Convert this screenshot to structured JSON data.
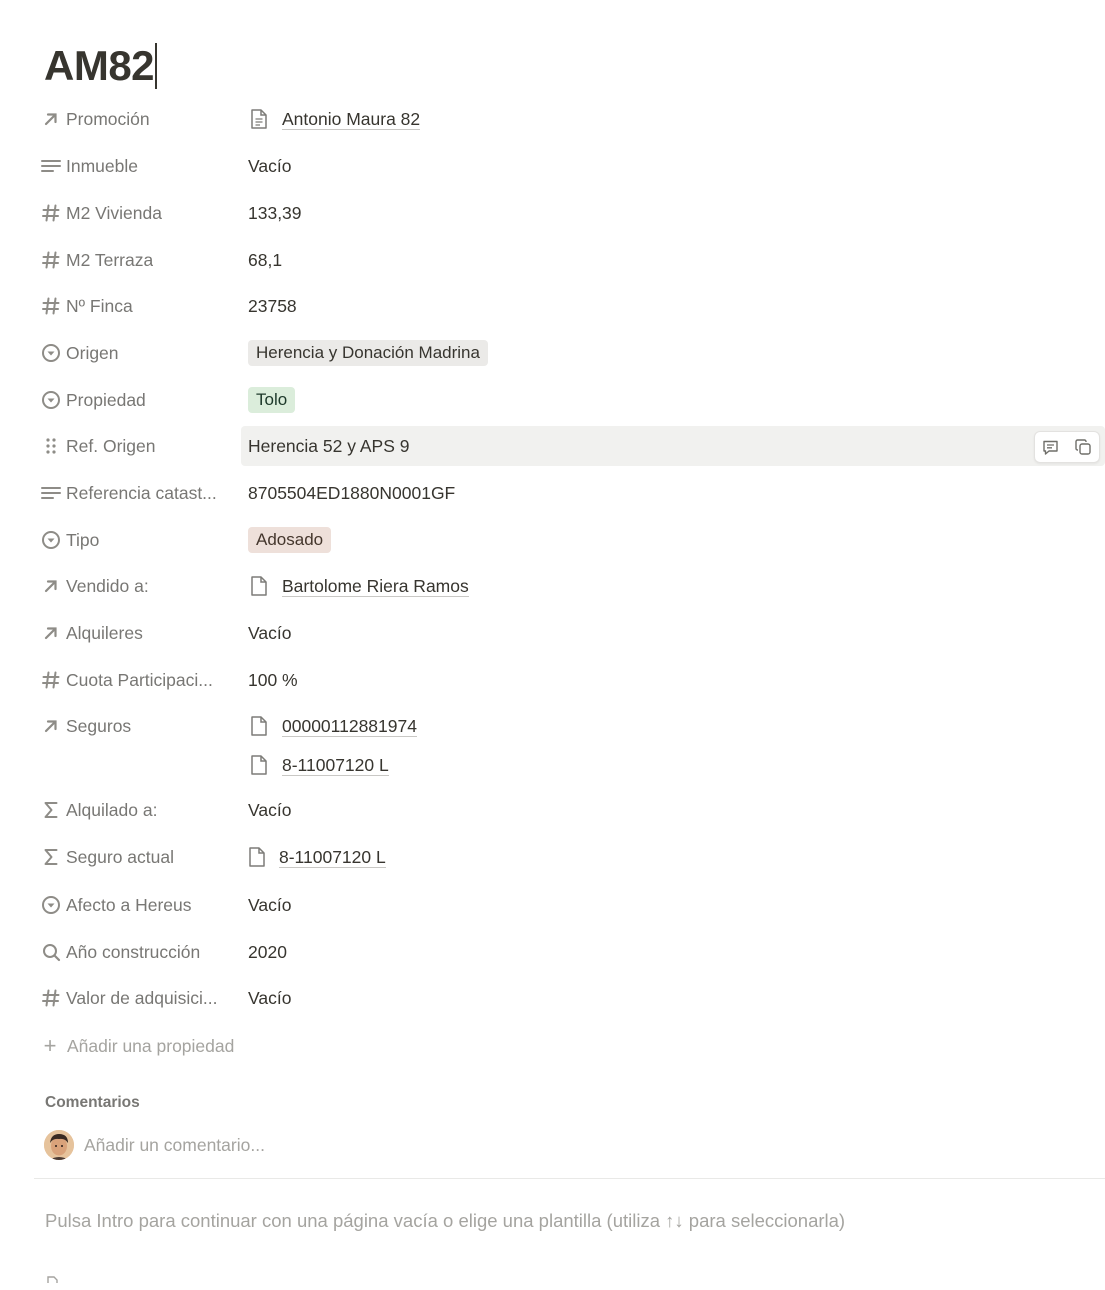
{
  "page": {
    "title": "AM82"
  },
  "properties": [
    {
      "icon": "arrow-up-right-icon",
      "name": "Promoción",
      "type": "relation",
      "values": [
        "Antonio Maura 82"
      ]
    },
    {
      "icon": "text-lines-icon",
      "name": "Inmueble",
      "type": "empty",
      "value": "Vacío"
    },
    {
      "icon": "hash-icon",
      "name": "M2 Vivienda",
      "type": "text",
      "value": "133,39"
    },
    {
      "icon": "hash-icon",
      "name": "M2 Terraza",
      "type": "text",
      "value": "68,1"
    },
    {
      "icon": "hash-icon",
      "name": "Nº Finca",
      "type": "text",
      "value": "23758"
    },
    {
      "icon": "select-circle-icon",
      "name": "Origen",
      "type": "tag",
      "value": "Herencia y Donación Madrina",
      "color": "#ebeae8"
    },
    {
      "icon": "select-circle-icon",
      "name": "Propiedad",
      "type": "tag",
      "value": "Tolo",
      "color": "#dbeddb"
    },
    {
      "icon": "drag-handle-icon",
      "name": "Ref. Origen",
      "type": "text",
      "value": "Herencia 52 y APS 9",
      "hovered": true
    },
    {
      "icon": "text-lines-icon",
      "name": "Referencia catast...",
      "type": "text",
      "value": "8705504ED1880N0001GF"
    },
    {
      "icon": "select-circle-icon",
      "name": "Tipo",
      "type": "tag",
      "value": "Adosado",
      "color": "#eee0da"
    },
    {
      "icon": "arrow-up-right-icon",
      "name": "Vendido a:",
      "type": "relation",
      "values": [
        "Bartolome Riera Ramos"
      ]
    },
    {
      "icon": "arrow-up-right-icon",
      "name": "Alquileres",
      "type": "empty",
      "value": "Vacío"
    },
    {
      "icon": "hash-icon",
      "name": "Cuota Participaci...",
      "type": "text",
      "value": "100 %"
    },
    {
      "icon": "arrow-up-right-icon",
      "name": "Seguros",
      "type": "relation",
      "values": [
        "00000112881974",
        "8-11007120 L"
      ]
    },
    {
      "icon": "sigma-icon",
      "name": "Alquilado a:",
      "type": "empty",
      "value": "Vacío"
    },
    {
      "icon": "sigma-icon",
      "name": "Seguro actual",
      "type": "relation",
      "values": [
        "8-11007120 L"
      ]
    },
    {
      "icon": "select-circle-icon",
      "name": "Afecto a Hereus",
      "type": "empty",
      "value": "Vacío"
    },
    {
      "icon": "search-icon",
      "name": "Año construcción",
      "type": "text",
      "value": "2020"
    },
    {
      "icon": "hash-icon",
      "name": "Valor de adquisici...",
      "type": "empty",
      "value": "Vacío"
    }
  ],
  "add_property": {
    "label": "Añadir una propiedad"
  },
  "comments": {
    "heading": "Comentarios",
    "placeholder": "Añadir un comentario..."
  },
  "hint": "Pulsa Intro para continuar con una página vacía o elige una plantilla (utiliza ↑↓ para seleccionarla)",
  "colors": {
    "text": "#37352f",
    "muted": "#787774",
    "placeholder": "#a5a4a0",
    "hover_bg": "#f1f1ef"
  }
}
